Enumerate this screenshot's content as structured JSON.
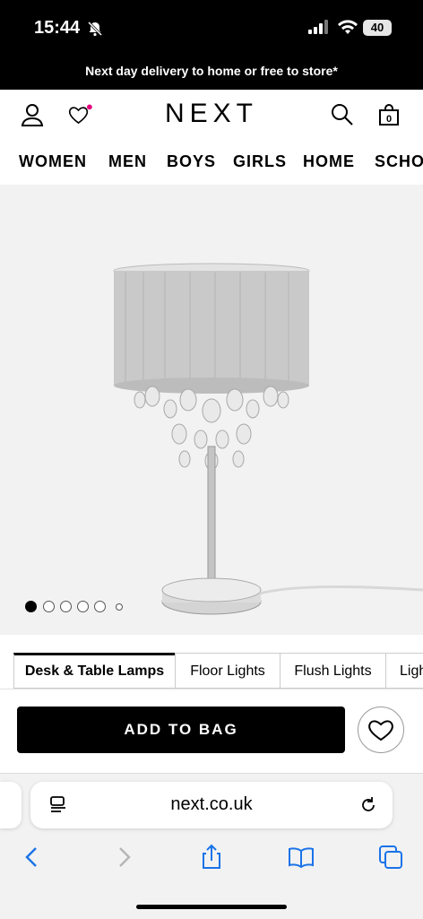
{
  "status_bar": {
    "time": "15:44",
    "battery": "40"
  },
  "banner": {
    "text": "Next day delivery to home or free to store*"
  },
  "header": {
    "logo": "NEXT",
    "bag_count": "0"
  },
  "nav": {
    "items": [
      "WOMEN",
      "MEN",
      "BOYS",
      "GIRLS",
      "HOME",
      "SCHO"
    ]
  },
  "carousel": {
    "total_slides": 6,
    "active_index": 0
  },
  "category_tabs": {
    "items": [
      "Desk & Table Lamps",
      "Floor Lights",
      "Flush Lights",
      "Ligh"
    ],
    "active_index": 0
  },
  "actions": {
    "add_to_bag": "ADD TO BAG"
  },
  "browser": {
    "url": "next.co.uk"
  },
  "colors": {
    "brand": "#000000",
    "notification_dot": "#e5007e",
    "link_blue": "#1a73e8"
  }
}
